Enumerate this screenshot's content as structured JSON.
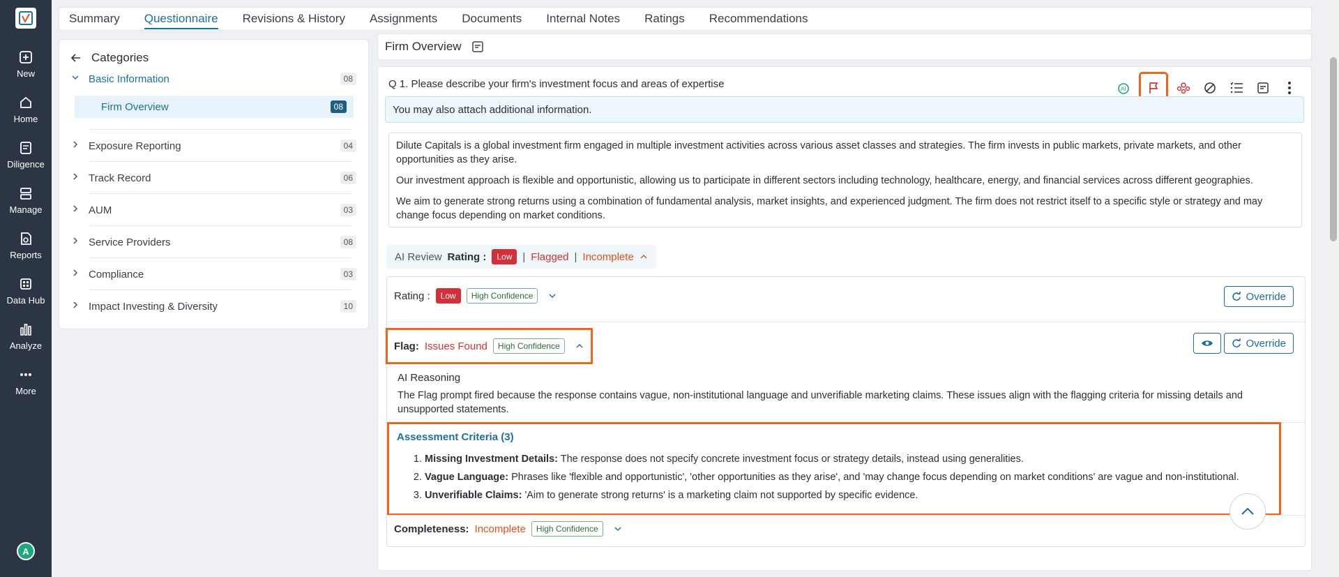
{
  "nav": {
    "items": [
      {
        "label": "New",
        "icon": "plus-square-icon"
      },
      {
        "label": "Home",
        "icon": "home-icon"
      },
      {
        "label": "Diligence",
        "icon": "diligence-icon"
      },
      {
        "label": "Manage",
        "icon": "manage-icon"
      },
      {
        "label": "Reports",
        "icon": "reports-icon"
      },
      {
        "label": "Data Hub",
        "icon": "data-hub-icon"
      },
      {
        "label": "Analyze",
        "icon": "bar-chart-icon"
      },
      {
        "label": "More",
        "icon": "more-dots-icon"
      }
    ],
    "avatar": "A"
  },
  "tabs": [
    "Summary",
    "Questionnaire",
    "Revisions & History",
    "Assignments",
    "Documents",
    "Internal Notes",
    "Ratings",
    "Recommendations"
  ],
  "categories": {
    "title": "Categories",
    "items": [
      {
        "label": "Basic Information",
        "count": "08"
      },
      {
        "label": "Exposure Reporting",
        "count": "04"
      },
      {
        "label": "Track Record",
        "count": "06"
      },
      {
        "label": "AUM",
        "count": "03"
      },
      {
        "label": "Service Providers",
        "count": "08"
      },
      {
        "label": "Compliance",
        "count": "03"
      },
      {
        "label": "Impact Investing & Diversity",
        "count": "10"
      }
    ],
    "sub": {
      "label": "Firm Overview",
      "count": "08"
    }
  },
  "section": {
    "title": "Firm Overview"
  },
  "question": {
    "title": "Q 1. Please describe your firm's investment focus and areas of expertise",
    "note": "You may also attach additional information.",
    "answer": [
      "Dilute Capitals is a global investment firm engaged in multiple investment activities across various asset classes and strategies. The firm invests in public markets, private markets, and other opportunities as they arise.",
      "Our investment approach is flexible and opportunistic, allowing us to participate in different sectors including technology, healthcare, energy, and financial services across different geographies.",
      "We aim to generate strong returns using a combination of fundamental analysis, market insights, and experienced judgment. The firm does not restrict itself to a specific style or strategy and may change focus depending on market conditions."
    ]
  },
  "ai_review": {
    "label": "AI Review",
    "rating_label": "Rating :",
    "rating": "Low",
    "flagged": "Flagged",
    "incomplete": "Incomplete",
    "sep": "|"
  },
  "review": {
    "rating_label": "Rating :",
    "rating": "Low",
    "confidence": "High Confidence",
    "override": "Override",
    "flag_label": "Flag:",
    "flag_value": "Issues Found",
    "reasoning_title": "AI Reasoning",
    "reasoning_text": "The Flag prompt fired because the response contains vague, non-institutional language and unverifiable marketing claims. These issues align with the flagging criteria for missing details and unsupported statements.",
    "criteria_title": "Assessment Criteria (3)",
    "criteria": [
      {
        "term": "Missing Investment Details:",
        "text": "The response does not specify concrete investment focus or strategy details, instead using generalities."
      },
      {
        "term": "Vague Language:",
        "text": "Phrases like 'flexible and opportunistic', 'other opportunities as they arise', and 'may change focus depending on market conditions' are vague and non-institutional."
      },
      {
        "term": "Unverifiable Claims:",
        "text": "'Aim to generate strong returns' is a marketing claim not supported by specific evidence."
      }
    ],
    "completeness_label": "Completeness:",
    "completeness_value": "Incomplete"
  },
  "colors": {
    "accent": "#1f6f9e",
    "danger": "#d3313a",
    "warning": "#e0511b",
    "highlight": "#f2641c",
    "rail": "#2b3544"
  }
}
